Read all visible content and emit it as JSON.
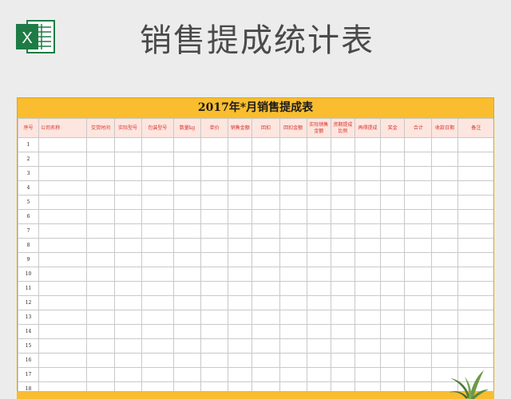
{
  "page": {
    "title": "销售提成统计表"
  },
  "logo": {
    "icon": "excel-icon",
    "letter": "X",
    "color": "#1e7b45"
  },
  "sheet": {
    "title": "2017年*月销售提成表",
    "headers": [
      "序号",
      "公司名称",
      "交货时间",
      "实际型号",
      "包装型号",
      "数量kg",
      "单价",
      "销售金额",
      "回扣",
      "回扣金额",
      "实际销售金额",
      "资期提成比例",
      "再得提成",
      "奖金",
      "合计",
      "收款日期",
      "备注"
    ],
    "rows": [
      "1",
      "2",
      "3",
      "4",
      "5",
      "6",
      "7",
      "8",
      "9",
      "10",
      "11",
      "12",
      "13",
      "14",
      "15",
      "16",
      "17",
      "18"
    ]
  },
  "colors": {
    "accent": "#f9bd2f",
    "header_bg": "#fde6df",
    "header_text": "#d8312a"
  }
}
